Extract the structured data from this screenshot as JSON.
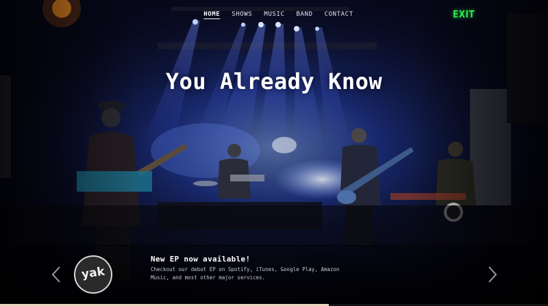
{
  "nav": {
    "items": [
      {
        "label": "HOME",
        "active": true
      },
      {
        "label": "SHOWS",
        "active": false
      },
      {
        "label": "MUSIC",
        "active": false
      },
      {
        "label": "BAND",
        "active": false
      },
      {
        "label": "CONTACT",
        "active": false
      }
    ]
  },
  "hero": {
    "title": "You Already Know"
  },
  "venue": {
    "exit_sign": "EXIT"
  },
  "news": {
    "title": "New EP now available!",
    "body": "Checkout our debut EP on Spotify, iTunes, Google Play, Amazon Music, and most other major services."
  },
  "logo": {
    "text": "yak"
  },
  "slider": {
    "prev_icon": "chevron-left-icon",
    "next_icon": "chevron-right-icon",
    "progress": 0.6
  },
  "colors": {
    "nav_text": "#e6e6ee",
    "exit_green": "#2ee84c",
    "stage_blue": "#1b3bd8"
  }
}
